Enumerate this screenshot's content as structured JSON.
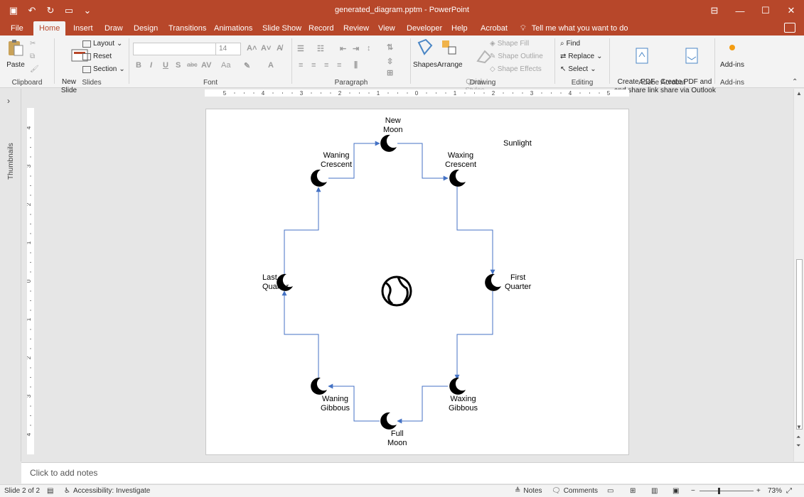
{
  "title_bar": {
    "document_title": "generated_diagram.pptm - PowerPoint",
    "qat_icons": [
      "save-icon",
      "undo-icon",
      "redo-icon",
      "present-icon",
      "customize-icon"
    ],
    "window_controls": [
      "ribbon-display-icon",
      "minimize-icon",
      "maximize-icon",
      "close-icon"
    ]
  },
  "tabs": [
    "File",
    "Home",
    "Insert",
    "Draw",
    "Design",
    "Transitions",
    "Animations",
    "Slide Show",
    "Record",
    "Review",
    "View",
    "Developer",
    "Help",
    "Acrobat"
  ],
  "active_tab": "Home",
  "tell_me": "Tell me what you want to do",
  "ribbon": {
    "clipboard": {
      "label": "Clipboard",
      "paste": "Paste"
    },
    "slides": {
      "label": "Slides",
      "new_slide": "New\nSlide",
      "layout": "Layout",
      "reset": "Reset",
      "section": "Section"
    },
    "font": {
      "label": "Font",
      "size": "14"
    },
    "paragraph": {
      "label": "Paragraph"
    },
    "drawing": {
      "label": "Drawing",
      "shapes": "Shapes",
      "arrange": "Arrange",
      "quick_styles": "Quick\nStyles",
      "shape_fill": "Shape Fill",
      "shape_outline": "Shape Outline",
      "shape_effects": "Shape Effects"
    },
    "editing": {
      "label": "Editing",
      "find": "Find",
      "replace": "Replace",
      "select": "Select"
    },
    "adobe": {
      "label": "Adobe Acrobat",
      "create_pdf": "Create PDF\nand share link",
      "create_pdf_outlook": "Create PDF and\nshare via Outlook"
    },
    "addins": {
      "label": "Add-ins",
      "btn": "Add-ins"
    }
  },
  "left_panel": {
    "thumbnails": "Thumbnails"
  },
  "ruler": {
    "h_ticks": [
      "5",
      "4",
      "3",
      "2",
      "1",
      "0",
      "1",
      "2",
      "3",
      "4",
      "5"
    ],
    "v_ticks": [
      "4",
      "3",
      "2",
      "1",
      "0",
      "1",
      "2",
      "3",
      "4"
    ]
  },
  "slide": {
    "sunlight": "Sunlight",
    "phases": {
      "new_moon": "New\nMoon",
      "waxing_crescent": "Waxing\nCrescent",
      "first_quarter": "First\nQuarter",
      "waxing_gibbous": "Waxing\nGibbous",
      "full_moon": "Full\nMoon",
      "waning_gibbous": "Waning\nGibbous",
      "last_quarter": "Last\nQuarter",
      "waning_crescent": "Waning\nCrescent"
    },
    "connector_color": "#4472c4"
  },
  "notes": {
    "placeholder": "Click to add notes"
  },
  "status": {
    "slide": "Slide 2 of 2",
    "accessibility": "Accessibility: Investigate",
    "notes": "Notes",
    "comments": "Comments",
    "zoom": "73%"
  },
  "colors": {
    "accent": "#b7472a",
    "ribbon_bg": "#f3f3f3"
  }
}
